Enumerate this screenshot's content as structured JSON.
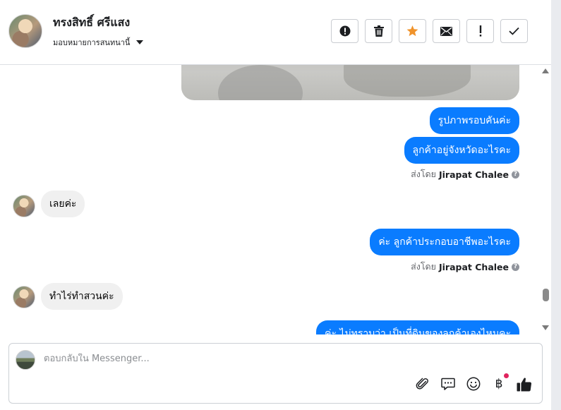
{
  "header": {
    "contact_name": "ทรงสิทธิ์ ศรีแสง",
    "assign_label": "มอบหมายการสนทนานี้",
    "actions": [
      {
        "name": "report-button",
        "icon": "alert-circle-icon",
        "color": "#1c1e21"
      },
      {
        "name": "delete-button",
        "icon": "trash-icon",
        "color": "#1c1e21"
      },
      {
        "name": "star-button",
        "icon": "star-icon",
        "color": "#f0932b"
      },
      {
        "name": "mark-unread-button",
        "icon": "envelope-icon",
        "color": "#1c1e21"
      },
      {
        "name": "spam-button",
        "icon": "exclamation-icon",
        "color": "#1c1e21"
      },
      {
        "name": "done-button",
        "icon": "check-icon",
        "color": "#1c1e21"
      }
    ]
  },
  "messages": {
    "out_1": "รูปภาพรอบคันค่ะ",
    "out_2": "ลูกค้าอยู่จังหวัดอะไรคะ",
    "sent_by_1": {
      "prefix": "ส่งโดย",
      "name": "Jirapat Chalee"
    },
    "in_1": "เลยค่ะ",
    "out_3": "ค่ะ ลูกค้าประกอบอาชีพอะไรคะ",
    "sent_by_2": {
      "prefix": "ส่งโดย",
      "name": "Jirapat Chalee"
    },
    "in_2": "ทำไร่ทำสวนค่ะ",
    "out_4": "ค่ะ ไม่ทราบว่า เป็นที่ดินของลูกค้าเองไหมคะ"
  },
  "composer": {
    "placeholder": "ตอบกลับใน Messenger...",
    "tools": [
      {
        "name": "attach-icon"
      },
      {
        "name": "saved-replies-icon"
      },
      {
        "name": "emoji-icon"
      },
      {
        "name": "baht-payment-icon",
        "glyph": "฿",
        "badge_color": "#e0245e"
      },
      {
        "name": "thumbs-up-icon"
      }
    ]
  },
  "colors": {
    "outgoing_bubble": "#0a7cff",
    "incoming_bubble": "#f0f0f0",
    "star": "#f0932b"
  }
}
